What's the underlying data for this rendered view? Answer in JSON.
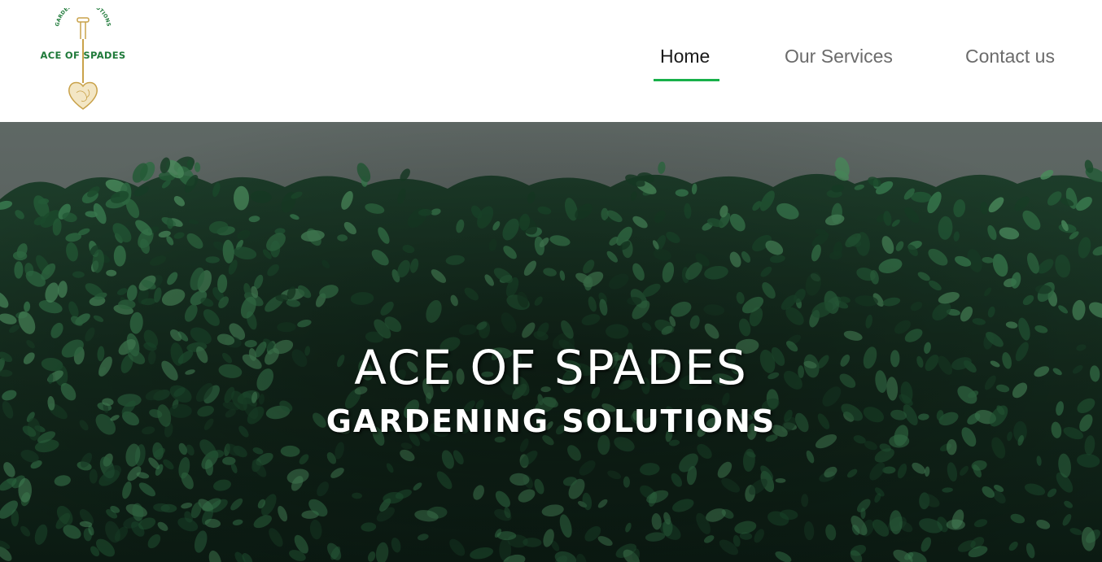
{
  "logo": {
    "arc_text": "GARDENING SOLUTIONS",
    "name": "ACE OF SPADES"
  },
  "nav": {
    "items": [
      {
        "label": "Home",
        "active": true
      },
      {
        "label": "Our Services",
        "active": false
      },
      {
        "label": "Contact us",
        "active": false
      }
    ]
  },
  "hero": {
    "title": "ACE OF SPADES",
    "subtitle": "GARDENING SOLUTIONS"
  },
  "colors": {
    "accent": "#18b04a",
    "logo_green": "#1f7a3a",
    "logo_gold": "#c9a24a",
    "nav_text": "#6b6b6b",
    "nav_active_text": "#1a1a1a",
    "hero_sky": "#5e6764",
    "hedge_dark": "#0f2a1c",
    "hedge_leaf": "#2f6b43"
  }
}
